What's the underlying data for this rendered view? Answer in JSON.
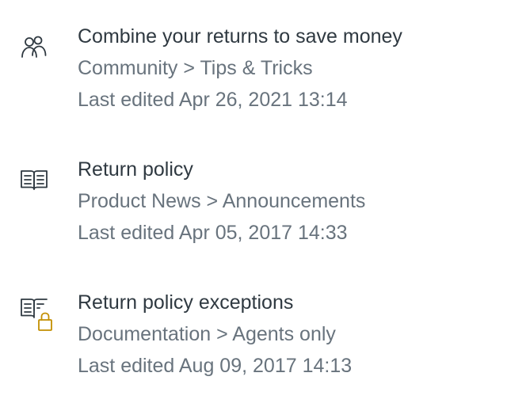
{
  "results": [
    {
      "icon": "community-users-icon",
      "title": "Combine your returns to save money",
      "path": "Community > Tips & Tricks",
      "edited": "Last edited Apr 26, 2021 13:14"
    },
    {
      "icon": "article-book-icon",
      "title": "Return policy",
      "path": "Product News > Announcements",
      "edited": "Last edited Apr 05, 2017 14:33"
    },
    {
      "icon": "restricted-article-lock-icon",
      "title": "Return policy exceptions",
      "path": "Documentation > Agents only",
      "edited": "Last edited Aug 09, 2017 14:13"
    }
  ],
  "colors": {
    "title": "#2f3941",
    "meta": "#68737d",
    "icon": "#2f3941",
    "lock": "#c38f00"
  }
}
